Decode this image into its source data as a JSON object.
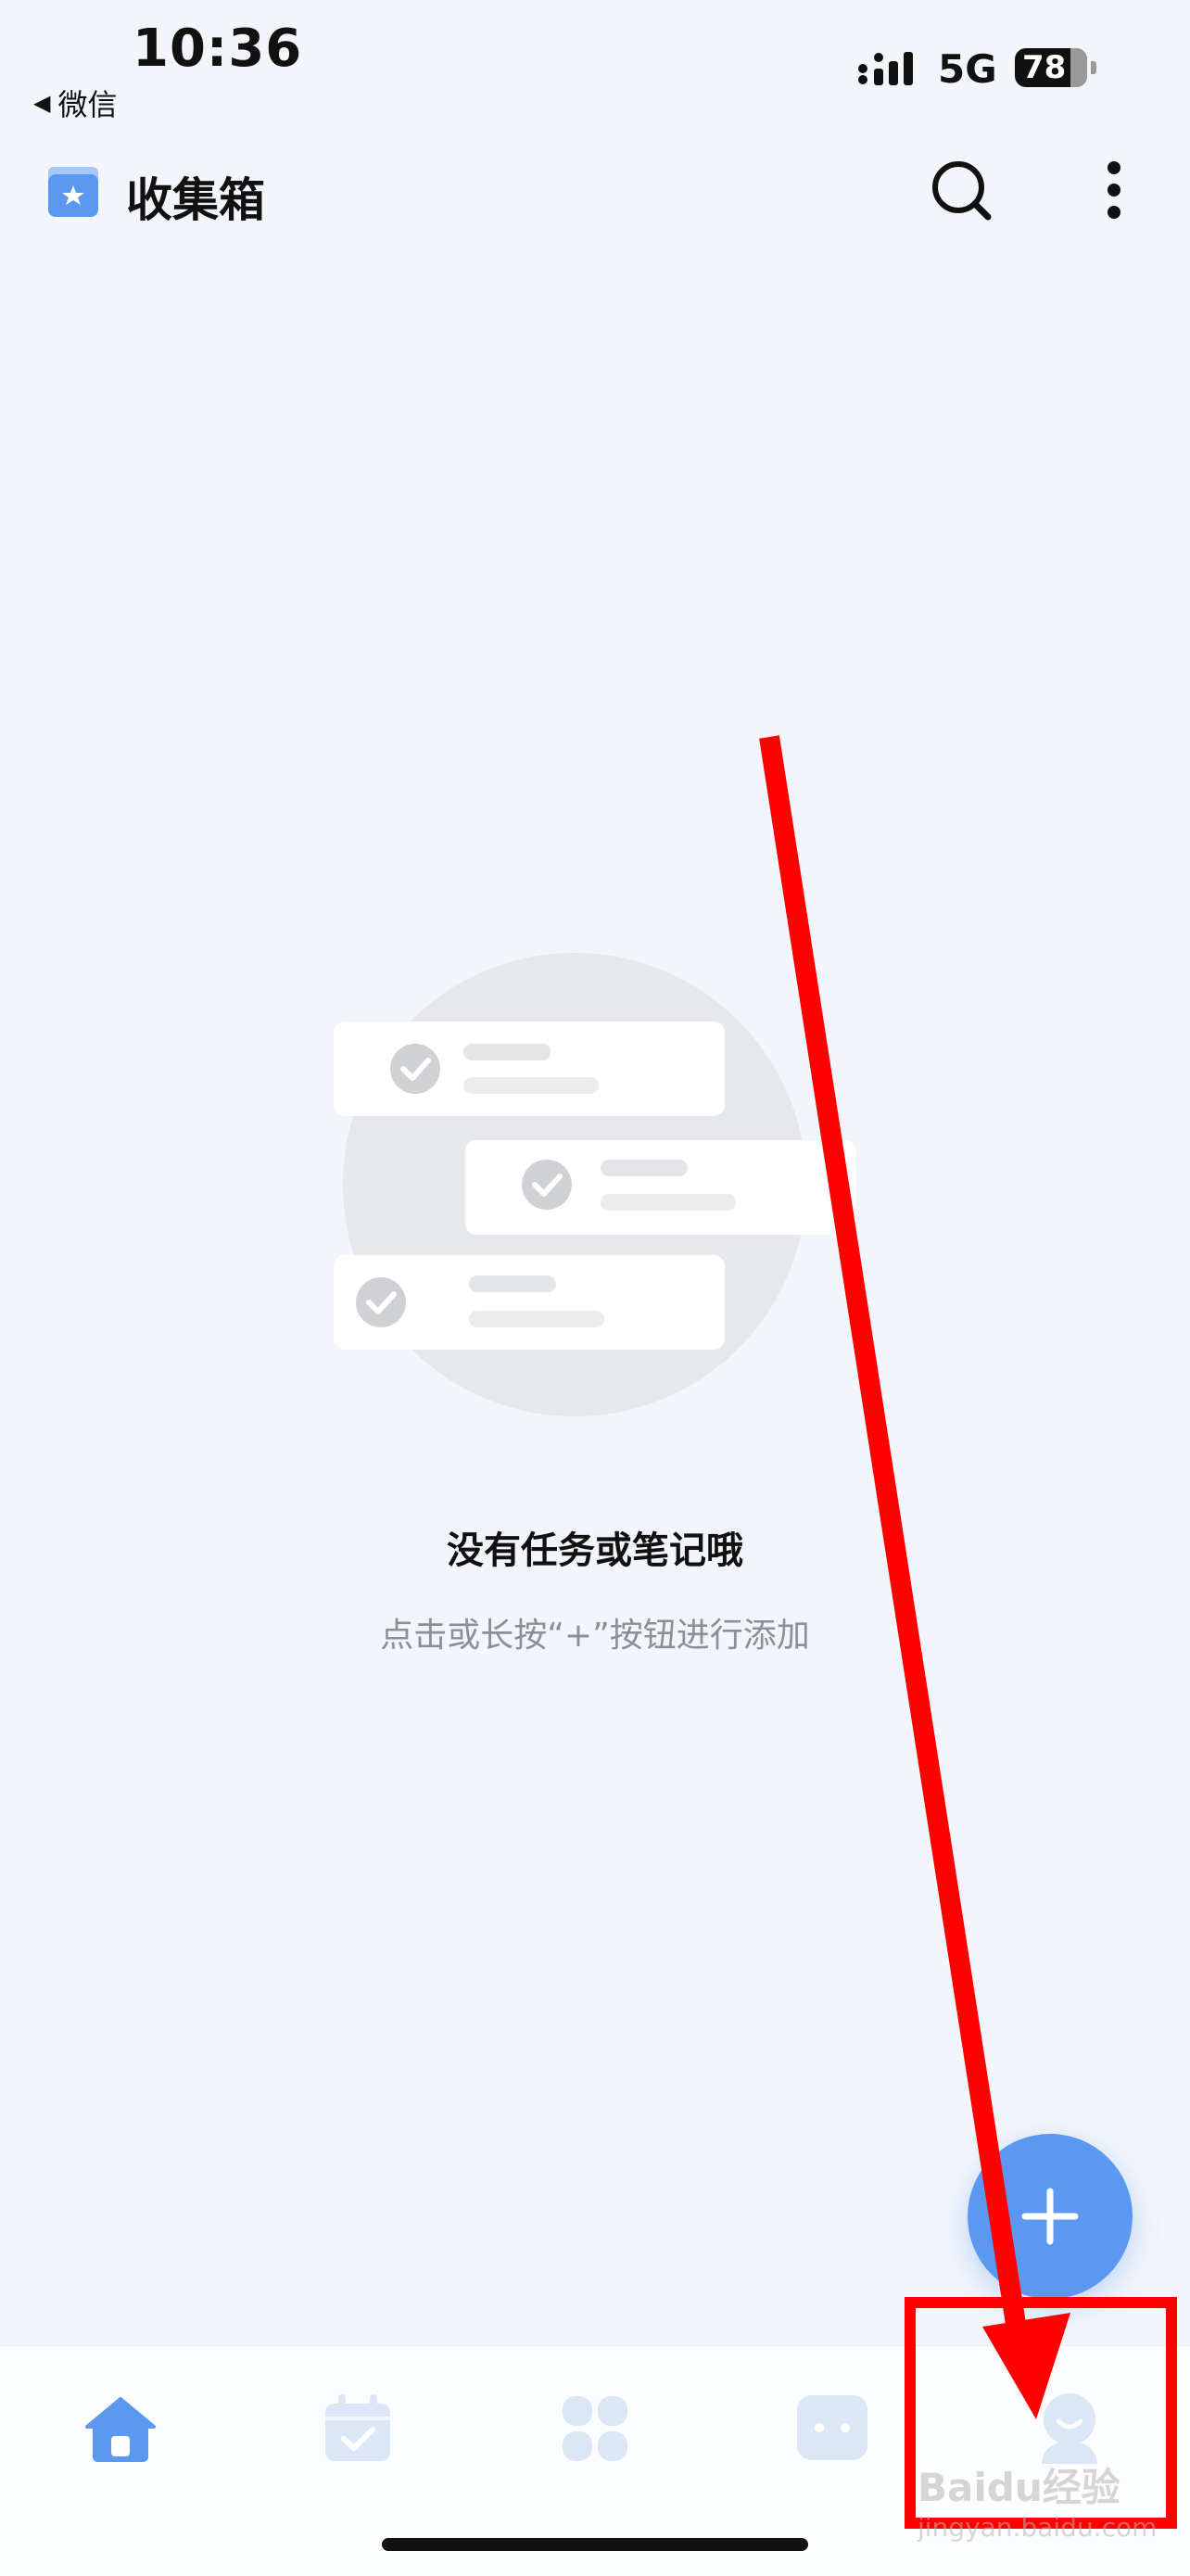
{
  "status_bar": {
    "time": "10:36",
    "back_label": "微信",
    "network": "5G",
    "battery": "78"
  },
  "header": {
    "title": "收集箱",
    "icons": [
      "inbox-icon",
      "search-icon",
      "more-vertical-icon"
    ]
  },
  "empty_state": {
    "title": "没有任务或笔记哦",
    "subtitle": "点击或长按“+”按钮进行添加"
  },
  "fab": {
    "icon": "plus-icon"
  },
  "bottom_nav": {
    "items": [
      {
        "icon": "home-icon",
        "active": true
      },
      {
        "icon": "calendar-check-icon",
        "active": false
      },
      {
        "icon": "grid-icon",
        "active": false
      },
      {
        "icon": "chat-icon",
        "active": false
      },
      {
        "icon": "profile-icon",
        "active": false
      }
    ]
  },
  "watermark": {
    "text": "Baidu经验",
    "url_text": "jingyan.baidu.com"
  },
  "colors": {
    "accent": "#5b98f2",
    "inactive_icon": "#dbe6f7",
    "background": "#f2f5fa",
    "annotation": "#ff0000"
  }
}
